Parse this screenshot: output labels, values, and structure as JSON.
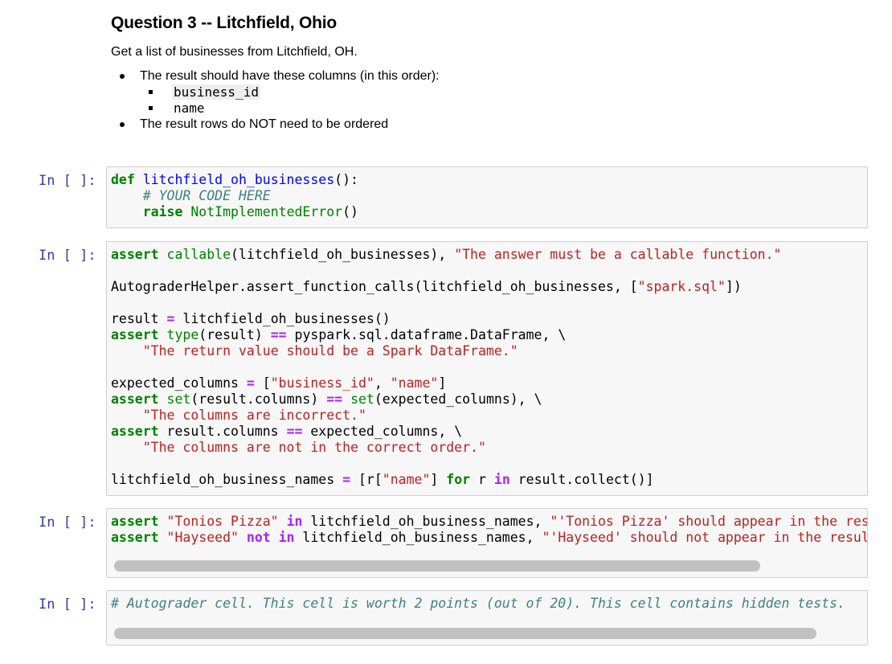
{
  "markdown": {
    "title": "Question 3 -- Litchfield, Ohio",
    "intro": "Get a list of businesses from Litchfield, OH.",
    "bullet1": "The result should have these columns (in this order):",
    "columns": [
      "business_id",
      "name"
    ],
    "bullet2": "The result rows do NOT need to be ordered"
  },
  "prompt": "In [ ]:",
  "cells": [
    {
      "id": "cell-1",
      "kind": "solution"
    },
    {
      "id": "cell-2",
      "kind": "test"
    },
    {
      "id": "cell-3",
      "kind": "test"
    },
    {
      "id": "cell-4",
      "kind": "autograder"
    }
  ]
}
